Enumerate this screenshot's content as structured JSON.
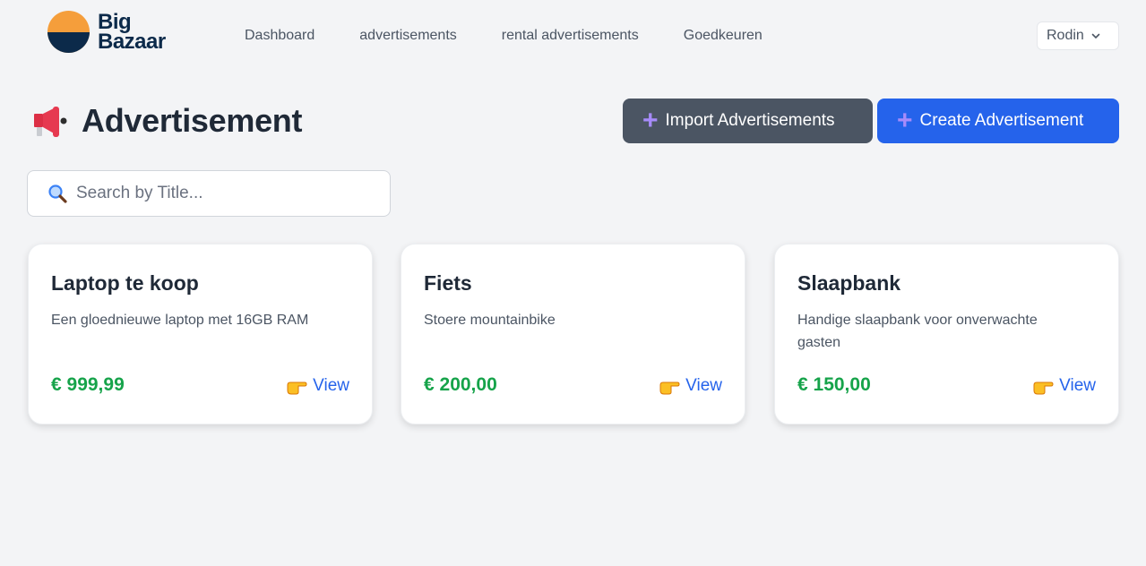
{
  "header": {
    "logo_line1": "Big",
    "logo_line2": "Bazaar",
    "nav": [
      "Dashboard",
      "advertisements",
      "rental advertisements",
      "Goedkeuren"
    ],
    "user": "Rodin"
  },
  "page": {
    "title": "Advertisement",
    "import_label": "Import Advertisements",
    "create_label": "Create Advertisement"
  },
  "search": {
    "placeholder": "Search by Title..."
  },
  "cards": [
    {
      "title": "Laptop te koop",
      "description": "Een gloednieuwe laptop met 16GB RAM",
      "price": "€ 999,99",
      "view_label": "View"
    },
    {
      "title": "Fiets",
      "description": "Stoere mountainbike",
      "price": "€ 200,00",
      "view_label": "View"
    },
    {
      "title": "Slaapbank",
      "description": "Handige slaapbank voor onverwachte gasten",
      "price": "€ 150,00",
      "view_label": "View"
    }
  ],
  "colors": {
    "primary": "#2563eb",
    "secondary": "#4b5563",
    "price": "#16a34a",
    "logo_orange": "#f59e3b",
    "logo_navy": "#0c2a4a"
  },
  "icons": {
    "title": "megaphone-icon",
    "button": "plus-icon",
    "search": "magnifier-icon",
    "view": "pointing-hand-icon",
    "user": "chevron-down-icon"
  }
}
